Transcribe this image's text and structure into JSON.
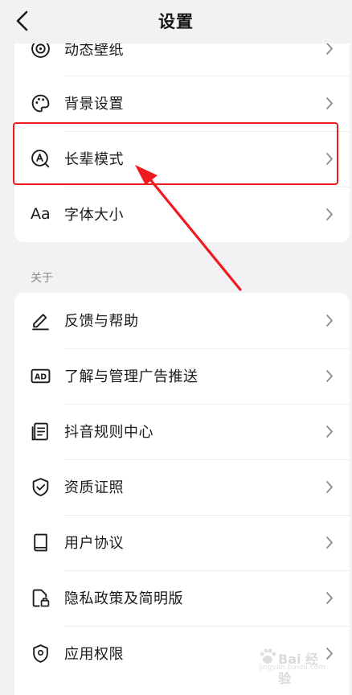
{
  "header": {
    "title": "设置",
    "back_icon": "back-chevron-icon"
  },
  "display_section": {
    "items": [
      {
        "label": "动态壁纸",
        "icon": "dynamic-wallpaper-icon"
      },
      {
        "label": "背景设置",
        "icon": "palette-icon"
      },
      {
        "label": "长辈模式",
        "icon": "elder-mode-icon",
        "highlighted": true
      },
      {
        "label": "字体大小",
        "icon": "font-size-icon"
      }
    ]
  },
  "about_section": {
    "label": "关于",
    "items": [
      {
        "label": "反馈与帮助",
        "icon": "pencil-icon"
      },
      {
        "label": "了解与管理广告推送",
        "icon": "ad-icon"
      },
      {
        "label": "抖音规则中心",
        "icon": "document-icon"
      },
      {
        "label": "资质证照",
        "icon": "shield-check-icon"
      },
      {
        "label": "用户协议",
        "icon": "book-icon"
      },
      {
        "label": "隐私政策及简明版",
        "icon": "privacy-lock-icon"
      },
      {
        "label": "应用权限",
        "icon": "location-shield-icon"
      }
    ]
  },
  "annotation": {
    "color": "#f0191e"
  },
  "watermark": {
    "text": "Bai 经验",
    "sub": "jingyan.baidu.com"
  }
}
